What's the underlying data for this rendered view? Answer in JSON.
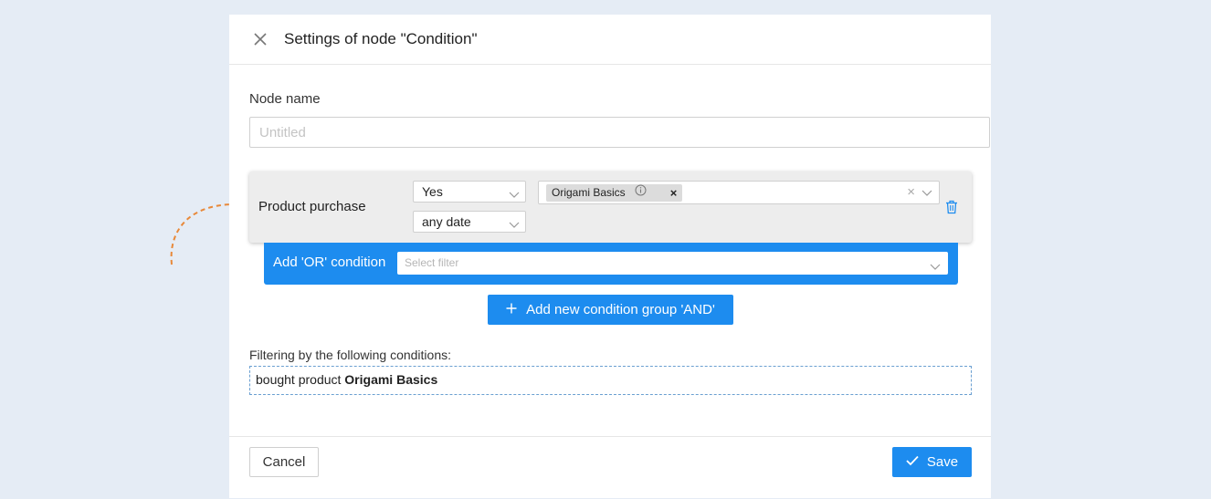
{
  "dialog": {
    "title": "Settings of node \"Condition\"",
    "node_name_label": "Node name",
    "node_name_placeholder": "Untitled",
    "node_name_value": ""
  },
  "condition": {
    "label": "Product purchase",
    "status_select": "Yes",
    "date_select": "any date",
    "products": [
      {
        "name": "Origami Basics"
      }
    ]
  },
  "or_condition": {
    "label": "Add 'OR' condition",
    "placeholder": "Select filter"
  },
  "add_and_button": "Add new condition group 'AND'",
  "filtering": {
    "label": "Filtering by the following conditions:",
    "prefix": "bought product",
    "product": "Origami Basics"
  },
  "footer": {
    "cancel": "Cancel",
    "save": "Save"
  },
  "colors": {
    "primary": "#1d8cef",
    "background": "#e5ecf5",
    "arrow": "#e8893a"
  }
}
